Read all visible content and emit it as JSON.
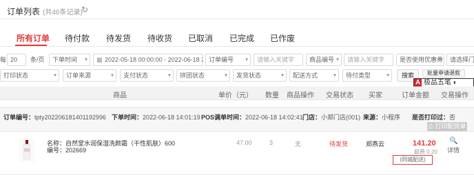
{
  "header": {
    "title": "订单列表",
    "count_text": "(共46条记录)",
    "refresh_icon": "refresh-icon"
  },
  "tabs": [
    {
      "label": "所有订单",
      "active": true
    },
    {
      "label": "待付款"
    },
    {
      "label": "待发货"
    },
    {
      "label": "待收货"
    },
    {
      "label": "已取消"
    },
    {
      "label": "已完成"
    },
    {
      "label": "已作废"
    }
  ],
  "filters": {
    "page_size_prefix": "每",
    "page_size": "20",
    "page_size_suffix": "条/页",
    "time_type": "下单时间",
    "date_range": "2022-05-18 00:00:00 - 2022-06-18 23:59:59",
    "field1": "订单编号",
    "keyword1_placeholder": "请输入关键字",
    "field2": "商品编号",
    "keyword2_placeholder": "请输入关键字",
    "coupon": "是否使用优惠券",
    "store": "请选择门店",
    "print_status": "打印状态",
    "order_source": "订单来源",
    "pay_status": "支付状态",
    "group_status": "拼团状态",
    "ship_status": "发货状态",
    "delivery_method": "配送方式",
    "pay_type": "待付类型",
    "search_label": "搜索",
    "batch_label": "批量申请退款"
  },
  "ime_bar": {
    "badge": "A",
    "text": "极品五笔"
  },
  "columns": [
    "商品",
    "单价（元）",
    "数量",
    "商品操作",
    "交易状态",
    "买家",
    "订单金额",
    "交易操作"
  ],
  "order": {
    "number_label": "订单编号：",
    "number": "tpty202206181401192996",
    "order_time_label": "下单时间：",
    "order_time": "2022-06-18 14:01:19",
    "pos_time_label": "POS调单时间：",
    "pos_time": "2022-06-18 14:02:41",
    "store_label": "门店：",
    "store": "小郑门店(001)",
    "source_label": "来源：",
    "source": "小程序",
    "printed_label": "是否打印过：",
    "printed": "否",
    "print_button": "打印配货单",
    "item": {
      "name_label": "名称：",
      "name": "自然堂水润保湿洗颜霜（干性肌肤）600",
      "code_label": "编号：",
      "code": "202669",
      "unit_price": "47.00",
      "quantity": "3",
      "item_action": "无",
      "status": "待发货",
      "buyer": "郑燕云",
      "total": "141.20",
      "shipping": "邮费 0.20",
      "delivery": "(同城配送)",
      "detail_label": "详情"
    }
  }
}
